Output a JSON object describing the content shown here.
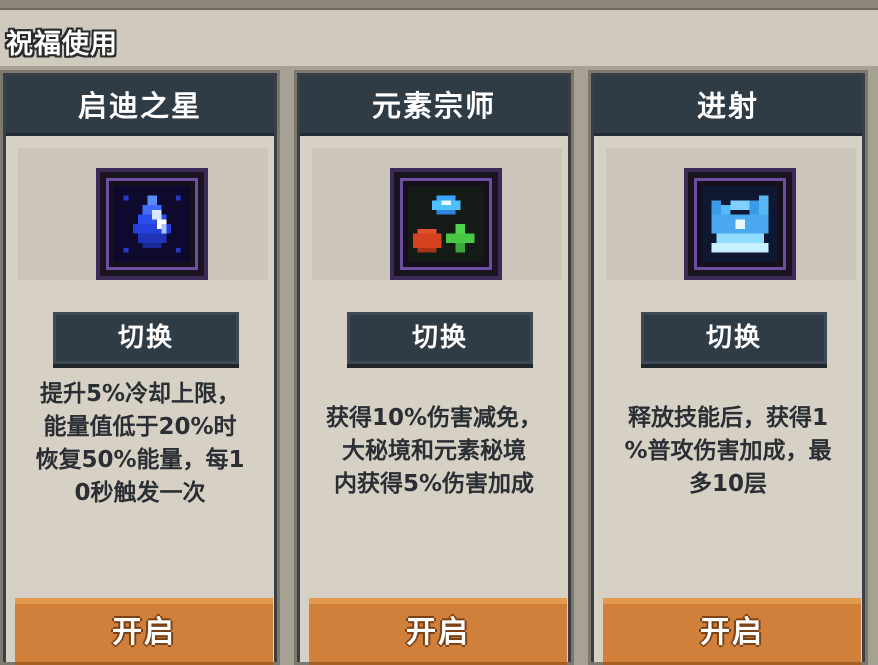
{
  "header": {
    "title": "祝福使用"
  },
  "cards": [
    {
      "title": "启迪之星",
      "icon": "blue-crystal-star-icon",
      "toggle_label": "切换",
      "description": "提升5%冷却上限，\n能量值低于20%时\n恢复50%能量，每1\n0秒触发一次",
      "open_label": "开启"
    },
    {
      "title": "元素宗师",
      "icon": "element-orbs-icon",
      "toggle_label": "切换",
      "description": "获得10%伤害减免，\n大秘境和元素秘境\n内获得5%伤害加成",
      "open_label": "开启"
    },
    {
      "title": "进射",
      "icon": "ice-shard-burst-icon",
      "toggle_label": "切换",
      "description": "释放技能后，获得1\n%普攻伤害加成，最\n多10层",
      "open_label": "开启"
    }
  ],
  "colors": {
    "title_bar": "#2f3b45",
    "card_bg": "#d6d1c4",
    "open_button": "#d0803a",
    "text_dark": "#2b2f34"
  }
}
